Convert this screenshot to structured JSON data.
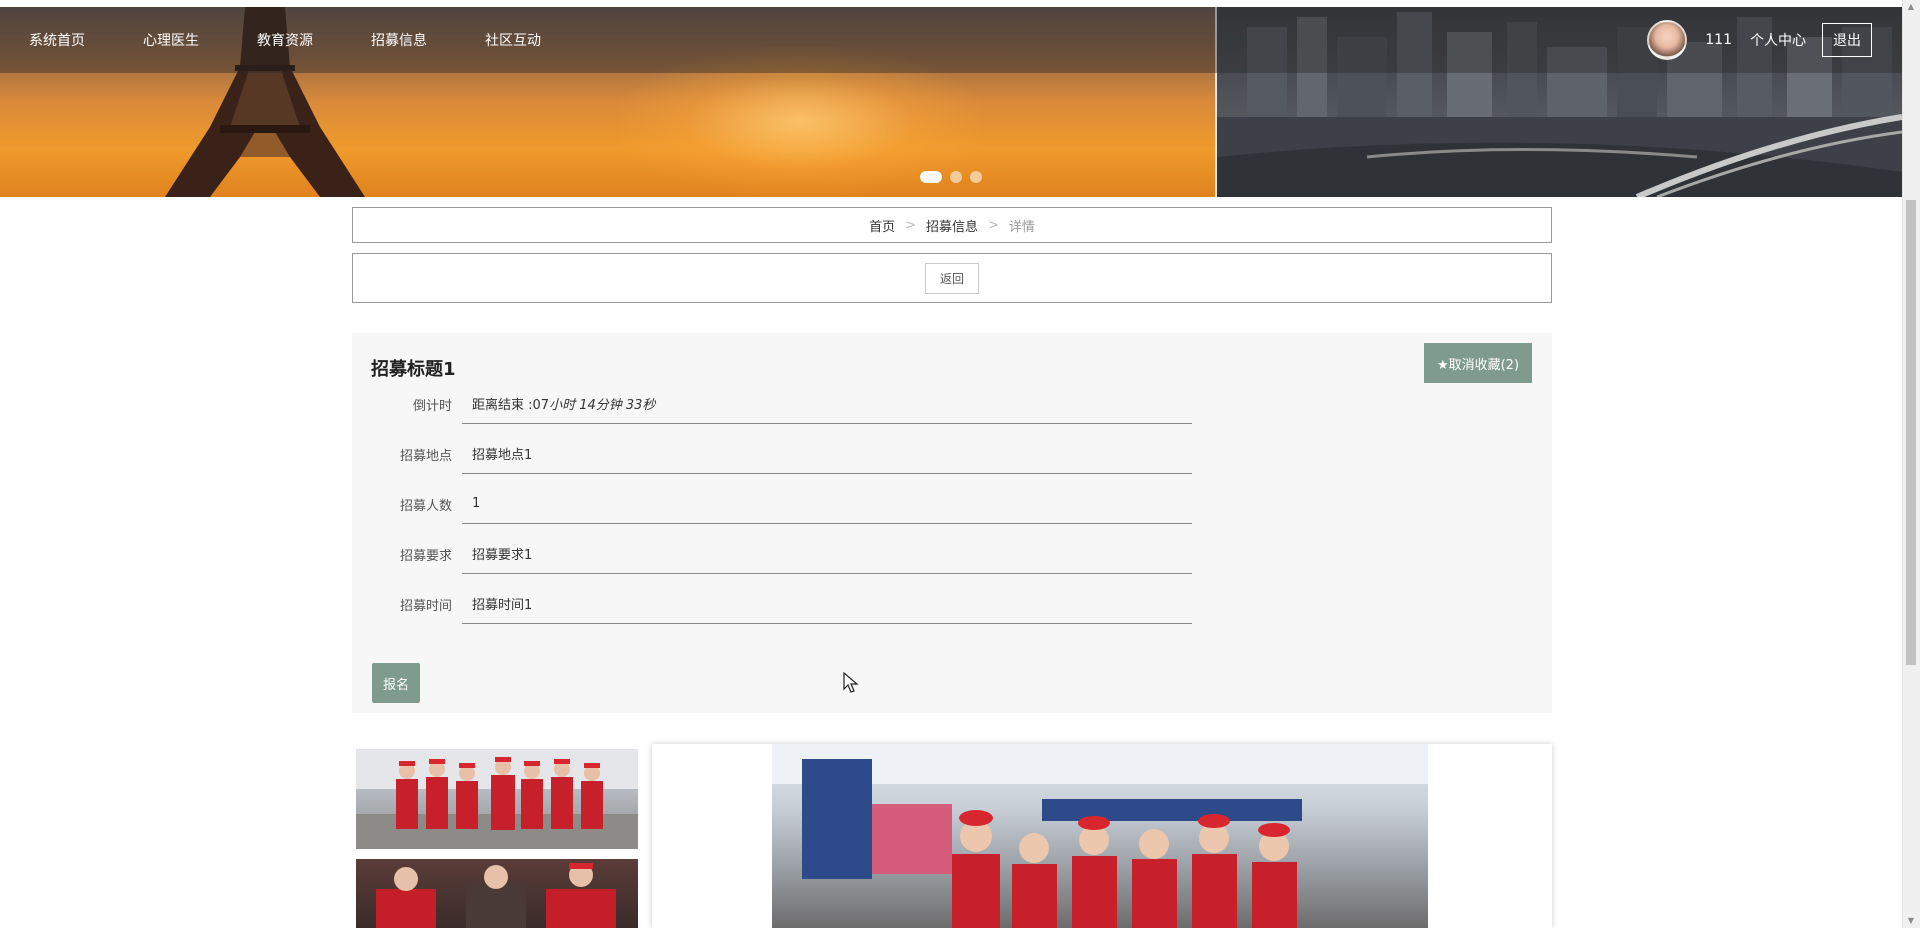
{
  "nav": {
    "items": [
      {
        "label": "系统首页"
      },
      {
        "label": "心理医生"
      },
      {
        "label": "教育资源"
      },
      {
        "label": "招募信息"
      },
      {
        "label": "社区互动"
      }
    ],
    "username": "111",
    "user_center": "个人中心",
    "logout": "退出"
  },
  "banner": {
    "dot_count": 3,
    "active_dot": 1
  },
  "breadcrumb": {
    "home": "首页",
    "section": "招募信息",
    "current": "详情",
    "separator": ">"
  },
  "back_label": "返回",
  "detail": {
    "title": "招募标题1",
    "favorite_label": "★取消收藏(2)",
    "fields": [
      {
        "label": "倒计时",
        "value_prefix": "距离结束 :07",
        "value_rest": "小时 14分钟 33秒"
      },
      {
        "label": "招募地点",
        "value": "招募地点1"
      },
      {
        "label": "招募人数",
        "value": "1"
      },
      {
        "label": "招募要求",
        "value": "招募要求1"
      },
      {
        "label": "招募时间",
        "value": "招募时间1"
      }
    ],
    "signup_label": "报名"
  },
  "colors": {
    "accent_green": "#7f9b8e",
    "nav_overlay": "rgba(40,40,40,0.42)"
  }
}
